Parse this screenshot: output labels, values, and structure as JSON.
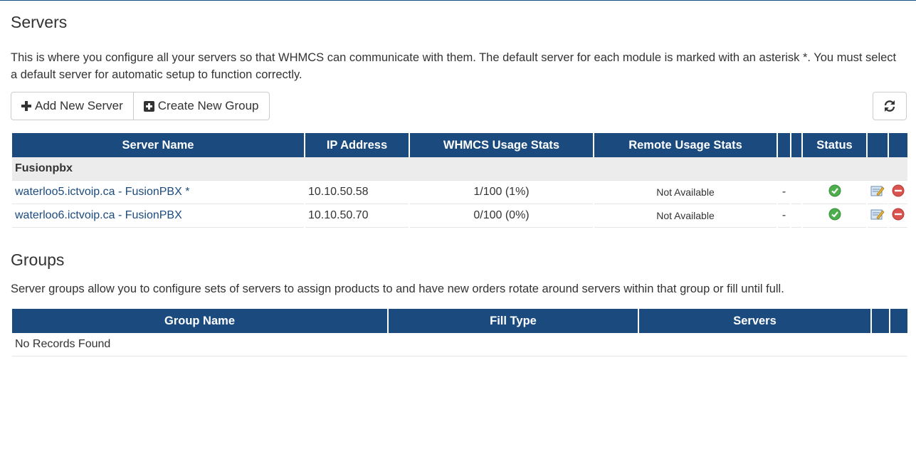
{
  "servers_section": {
    "title": "Servers",
    "intro": "This is where you configure all your servers so that WHMCS can communicate with them. The default server for each module is marked with an asterisk *. You must select a default server for automatic setup to function correctly.",
    "add_button": "Add New Server",
    "create_group_button": "Create New Group",
    "columns": [
      "Server Name",
      "IP Address",
      "WHMCS Usage Stats",
      "Remote Usage Stats",
      "Status"
    ],
    "groups": [
      {
        "name": "Fusionpbx",
        "rows": [
          {
            "name": "waterloo5.ictvoip.ca - FusionPBX *",
            "ip": "10.10.50.58",
            "whmcs_usage": "1/100 (1%)",
            "remote_usage": "Not Available",
            "dash": "-",
            "status": "active"
          },
          {
            "name": "waterloo6.ictvoip.ca - FusionPBX",
            "ip": "10.10.50.70",
            "whmcs_usage": "0/100 (0%)",
            "remote_usage": "Not Available",
            "dash": "-",
            "status": "active"
          }
        ]
      }
    ]
  },
  "groups_section": {
    "title": "Groups",
    "intro": "Server groups allow you to configure sets of servers to assign products to and have new orders rotate around servers within that group or fill until full.",
    "columns": [
      "Group Name",
      "Fill Type",
      "Servers"
    ],
    "empty_text": "No Records Found"
  },
  "colors": {
    "header_bg": "#1b4b7e",
    "link": "#1b4b7e",
    "group_row_bg": "#ececec",
    "status_ok": "#4cae4c",
    "delete": "#d9534f"
  }
}
